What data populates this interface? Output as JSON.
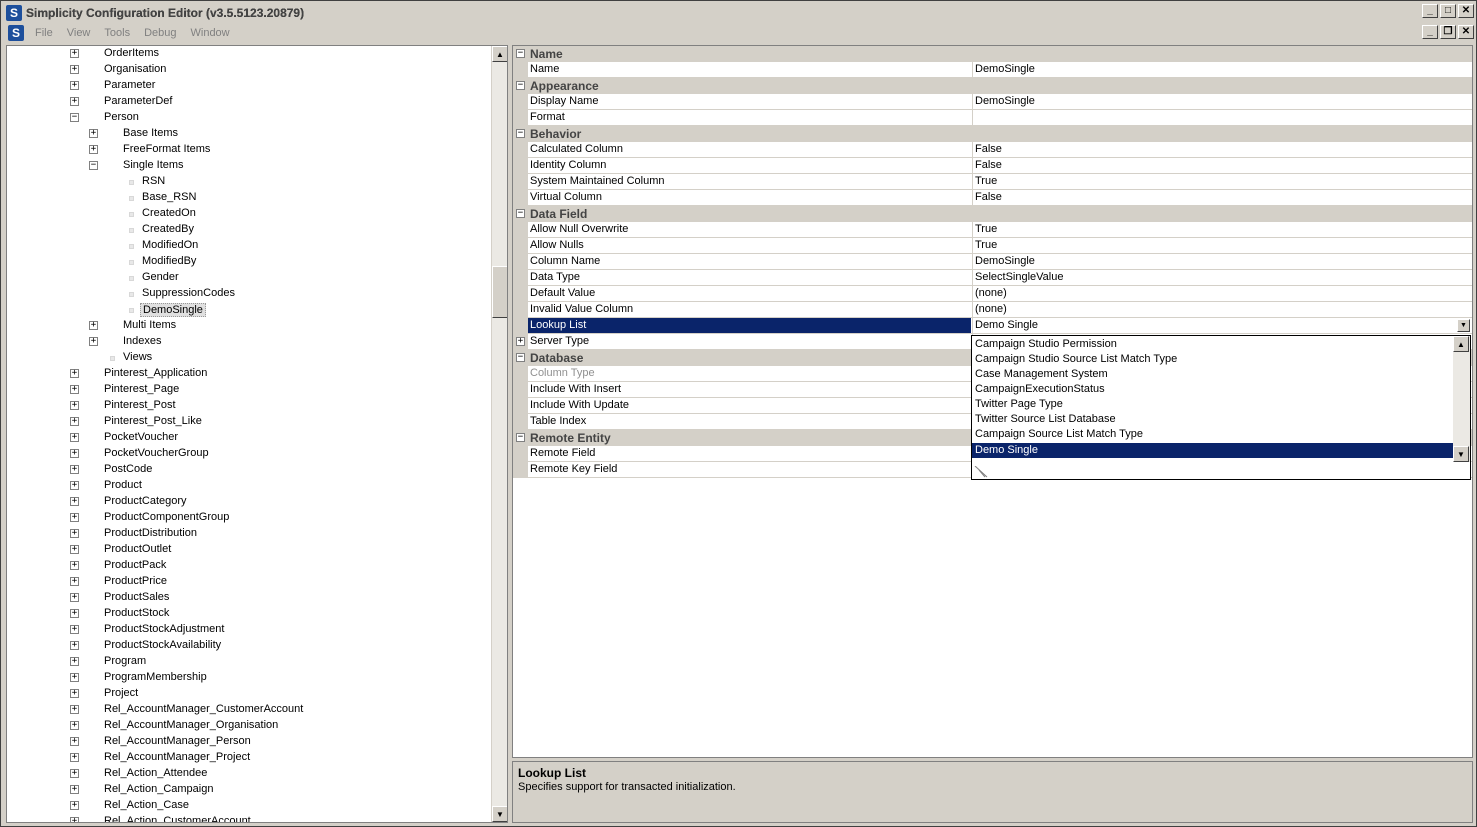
{
  "window": {
    "title": "Simplicity Configuration Editor (v3.5.5123.20879)",
    "app_icon_letter": "S",
    "controls": {
      "minimize": "_",
      "maximize": "□",
      "close": "✕",
      "restore": "❐"
    }
  },
  "menubar": {
    "items": [
      "File",
      "View",
      "Tools",
      "Debug",
      "Window"
    ]
  },
  "tree": {
    "items": [
      {
        "label": "OrderItems",
        "level": 0,
        "expander": "+"
      },
      {
        "label": "Organisation",
        "level": 0,
        "expander": "+"
      },
      {
        "label": "Parameter",
        "level": 0,
        "expander": "+"
      },
      {
        "label": "ParameterDef",
        "level": 0,
        "expander": "+"
      },
      {
        "label": "Person",
        "level": 0,
        "expander": "−"
      },
      {
        "label": "Base Items",
        "level": 1,
        "expander": "+"
      },
      {
        "label": "FreeFormat Items",
        "level": 1,
        "expander": "+"
      },
      {
        "label": "Single Items",
        "level": 1,
        "expander": "−"
      },
      {
        "label": "RSN",
        "level": 2,
        "expander": ""
      },
      {
        "label": "Base_RSN",
        "level": 2,
        "expander": ""
      },
      {
        "label": "CreatedOn",
        "level": 2,
        "expander": ""
      },
      {
        "label": "CreatedBy",
        "level": 2,
        "expander": ""
      },
      {
        "label": "ModifiedOn",
        "level": 2,
        "expander": ""
      },
      {
        "label": "ModifiedBy",
        "level": 2,
        "expander": ""
      },
      {
        "label": "Gender",
        "level": 2,
        "expander": ""
      },
      {
        "label": "SuppressionCodes",
        "level": 2,
        "expander": ""
      },
      {
        "label": "DemoSingle",
        "level": 2,
        "expander": "",
        "selected": true
      },
      {
        "label": "Multi Items",
        "level": 1,
        "expander": "+"
      },
      {
        "label": "Indexes",
        "level": 1,
        "expander": "+"
      },
      {
        "label": "Views",
        "level": 1,
        "expander": ""
      },
      {
        "label": "Pinterest_Application",
        "level": 0,
        "expander": "+"
      },
      {
        "label": "Pinterest_Page",
        "level": 0,
        "expander": "+"
      },
      {
        "label": "Pinterest_Post",
        "level": 0,
        "expander": "+"
      },
      {
        "label": "Pinterest_Post_Like",
        "level": 0,
        "expander": "+"
      },
      {
        "label": "PocketVoucher",
        "level": 0,
        "expander": "+"
      },
      {
        "label": "PocketVoucherGroup",
        "level": 0,
        "expander": "+"
      },
      {
        "label": "PostCode",
        "level": 0,
        "expander": "+"
      },
      {
        "label": "Product",
        "level": 0,
        "expander": "+"
      },
      {
        "label": "ProductCategory",
        "level": 0,
        "expander": "+"
      },
      {
        "label": "ProductComponentGroup",
        "level": 0,
        "expander": "+"
      },
      {
        "label": "ProductDistribution",
        "level": 0,
        "expander": "+"
      },
      {
        "label": "ProductOutlet",
        "level": 0,
        "expander": "+"
      },
      {
        "label": "ProductPack",
        "level": 0,
        "expander": "+"
      },
      {
        "label": "ProductPrice",
        "level": 0,
        "expander": "+"
      },
      {
        "label": "ProductSales",
        "level": 0,
        "expander": "+"
      },
      {
        "label": "ProductStock",
        "level": 0,
        "expander": "+"
      },
      {
        "label": "ProductStockAdjustment",
        "level": 0,
        "expander": "+"
      },
      {
        "label": "ProductStockAvailability",
        "level": 0,
        "expander": "+"
      },
      {
        "label": "Program",
        "level": 0,
        "expander": "+"
      },
      {
        "label": "ProgramMembership",
        "level": 0,
        "expander": "+"
      },
      {
        "label": "Project",
        "level": 0,
        "expander": "+"
      },
      {
        "label": "Rel_AccountManager_CustomerAccount",
        "level": 0,
        "expander": "+"
      },
      {
        "label": "Rel_AccountManager_Organisation",
        "level": 0,
        "expander": "+"
      },
      {
        "label": "Rel_AccountManager_Person",
        "level": 0,
        "expander": "+"
      },
      {
        "label": "Rel_AccountManager_Project",
        "level": 0,
        "expander": "+"
      },
      {
        "label": "Rel_Action_Attendee",
        "level": 0,
        "expander": "+"
      },
      {
        "label": "Rel_Action_Campaign",
        "level": 0,
        "expander": "+"
      },
      {
        "label": "Rel_Action_Case",
        "level": 0,
        "expander": "+"
      },
      {
        "label": "Rel_Action_CustomerAccount",
        "level": 0,
        "expander": "+"
      }
    ]
  },
  "properties": {
    "rows": [
      {
        "type": "cat",
        "name": "Name"
      },
      {
        "type": "prop",
        "name": "Name",
        "value": "DemoSingle"
      },
      {
        "type": "cat",
        "name": "Appearance"
      },
      {
        "type": "prop",
        "name": "Display Name",
        "value": "DemoSingle"
      },
      {
        "type": "prop",
        "name": "Format",
        "value": ""
      },
      {
        "type": "cat",
        "name": "Behavior"
      },
      {
        "type": "prop",
        "name": "Calculated Column",
        "value": "False"
      },
      {
        "type": "prop",
        "name": "Identity Column",
        "value": "False"
      },
      {
        "type": "prop",
        "name": "System Maintained Column",
        "value": "True"
      },
      {
        "type": "prop",
        "name": "Virtual Column",
        "value": "False"
      },
      {
        "type": "cat",
        "name": "Data Field"
      },
      {
        "type": "prop",
        "name": "Allow Null Overwrite",
        "value": "True"
      },
      {
        "type": "prop",
        "name": "Allow Nulls",
        "value": "True"
      },
      {
        "type": "prop",
        "name": "Column Name",
        "value": "DemoSingle"
      },
      {
        "type": "prop",
        "name": "Data Type",
        "value": "SelectSingleValue"
      },
      {
        "type": "prop",
        "name": "Default Value",
        "value": "(none)"
      },
      {
        "type": "prop",
        "name": "Invalid Value Column",
        "value": "(none)"
      },
      {
        "type": "prop",
        "name": "Lookup List",
        "value": "Demo Single",
        "selected": true
      },
      {
        "type": "prop",
        "name": "Server Type",
        "value": "",
        "expander": "+"
      },
      {
        "type": "cat",
        "name": "Database"
      },
      {
        "type": "prop",
        "name": "Column Type",
        "value": "",
        "disabled": true
      },
      {
        "type": "prop",
        "name": "Include With Insert",
        "value": ""
      },
      {
        "type": "prop",
        "name": "Include With Update",
        "value": ""
      },
      {
        "type": "prop",
        "name": "Table Index",
        "value": ""
      },
      {
        "type": "cat",
        "name": "Remote Entity"
      },
      {
        "type": "prop",
        "name": "Remote Field",
        "value": ""
      },
      {
        "type": "prop",
        "name": "Remote Key Field",
        "value": ""
      }
    ]
  },
  "dropdown": {
    "options": [
      "Campaign Studio Permission",
      "Campaign Studio Source List Match Type",
      "Case Management System",
      "CampaignExecutionStatus",
      "Twitter Page Type",
      "Twitter Source List Database",
      "Campaign Source List Match Type",
      "Demo Single"
    ],
    "selected": "Demo Single"
  },
  "description": {
    "title": "Lookup List",
    "text": "Specifies support for transacted initialization."
  }
}
